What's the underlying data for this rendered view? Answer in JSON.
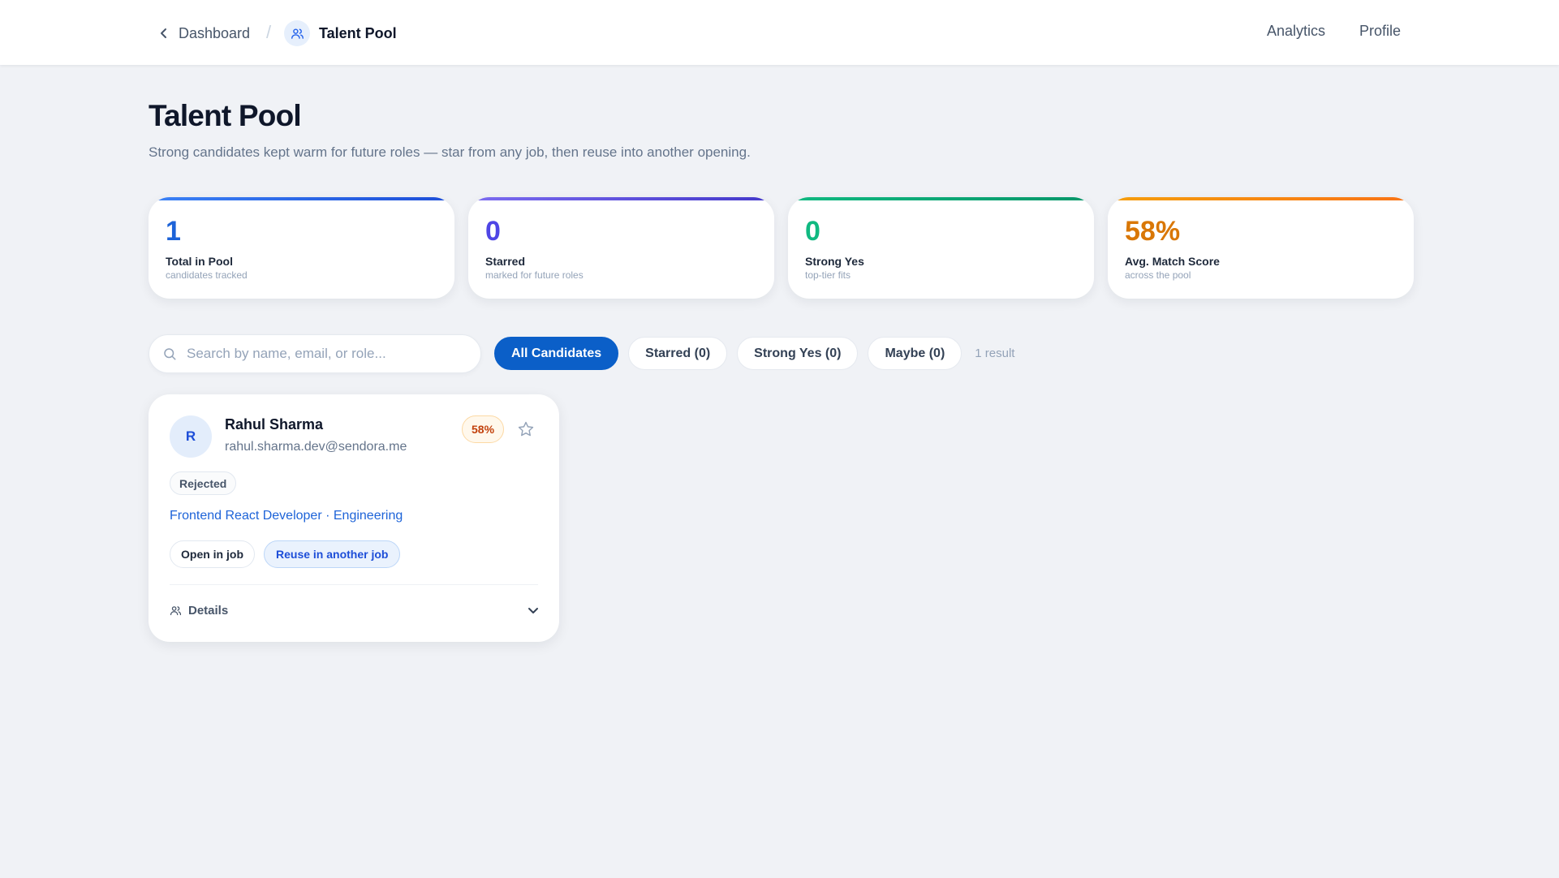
{
  "nav": {
    "back_label": "Dashboard",
    "separator": "/",
    "current_label": "Talent Pool",
    "right_links": [
      "Analytics",
      "Profile"
    ]
  },
  "page": {
    "title": "Talent Pool",
    "subtitle": "Strong candidates kept warm for future roles — star from any job, then reuse into another opening."
  },
  "stats": [
    {
      "value": "1",
      "label": "Total in Pool",
      "sub": "candidates tracked",
      "color": "#1d63d8",
      "bar": "#1d63d8"
    },
    {
      "value": "0",
      "label": "Starred",
      "sub": "marked for future roles",
      "color": "#4f46e5",
      "bar": "#5b4be0"
    },
    {
      "value": "0",
      "label": "Strong Yes",
      "sub": "top-tier fits",
      "color": "#10b981",
      "bar": "#10b981"
    },
    {
      "value": "58%",
      "label": "Avg. Match Score",
      "sub": "across the pool",
      "color": "#d97706",
      "bar": "#f59e0b"
    }
  ],
  "search": {
    "placeholder": "Search by name, email, or role...",
    "value": ""
  },
  "filters": {
    "chips": [
      "All Candidates",
      "Starred (0)",
      "Strong Yes (0)",
      "Maybe (0)"
    ],
    "active_index": 0,
    "result_count": "1 result"
  },
  "candidate": {
    "initial": "R",
    "name": "Rahul Sharma",
    "email": "rahul.sharma.dev@sendora.me",
    "score": "58%",
    "status": "Rejected",
    "job": "Frontend React Developer · Engineering",
    "open_label": "Open in job",
    "reuse_label": "Reuse in another job",
    "details_label": "Details"
  }
}
